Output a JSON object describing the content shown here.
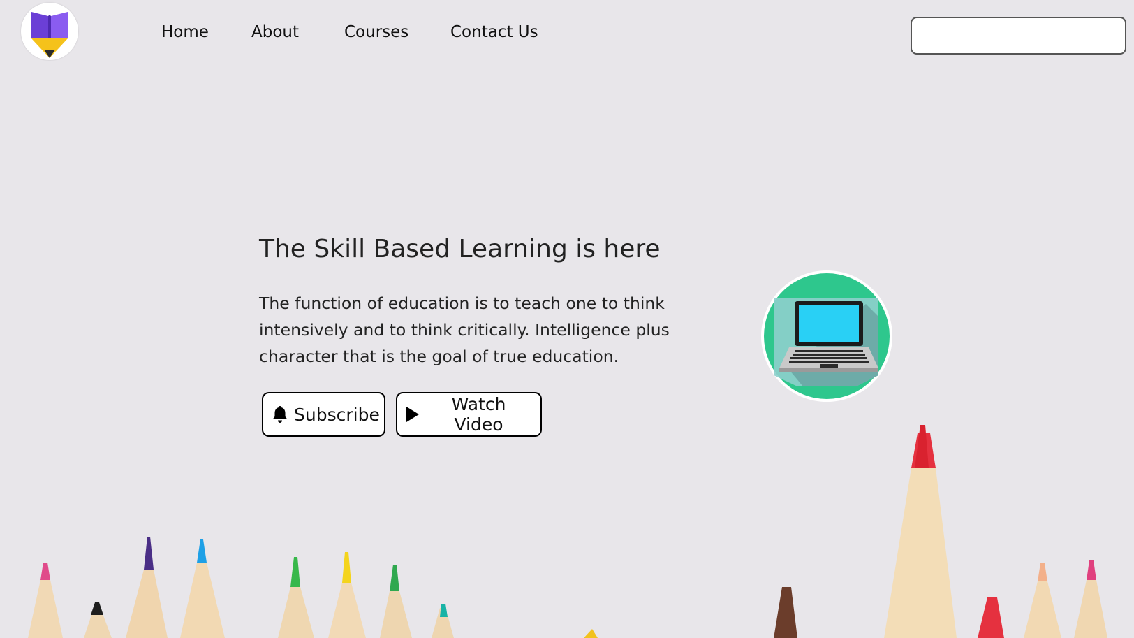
{
  "nav": {
    "links": [
      {
        "label": "Home"
      },
      {
        "label": "About"
      },
      {
        "label": "Courses"
      },
      {
        "label": "Contact Us"
      }
    ]
  },
  "search": {
    "value": "",
    "placeholder": ""
  },
  "hero": {
    "title": "The Skill Based Learning is here",
    "description": "The function of education is to teach one to think intensively and to think critically. Intelligence plus character that is the goal of true education.",
    "buttons": {
      "subscribe": {
        "label": "Subscribe",
        "icon": "bell-icon"
      },
      "watch": {
        "label": "Watch Video",
        "icon": "play-icon"
      }
    }
  },
  "icons": {
    "logo": "book-pencil-logo",
    "hero_image": "laptop-icon"
  },
  "colors": {
    "background": "#e8e6ea",
    "logo_book": "#7a4fe0",
    "logo_pencil": "#f5c21b",
    "laptop_circle": "#2ec78d",
    "laptop_screen": "#29d0f5"
  }
}
